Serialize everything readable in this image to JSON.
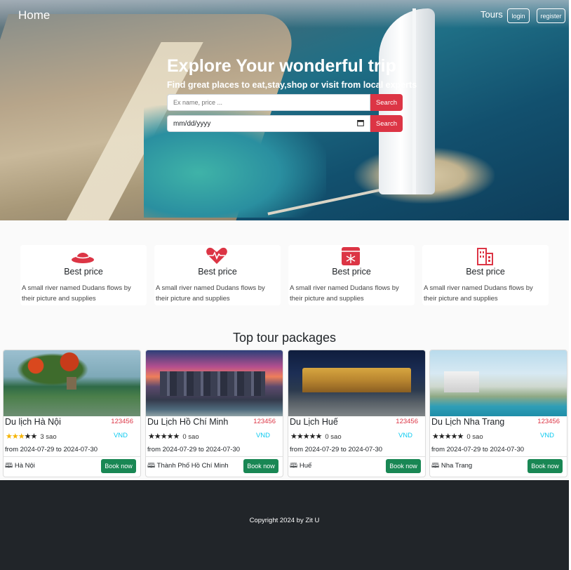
{
  "navbar": {
    "brand": "Home",
    "tours_link": "Tours",
    "login_button": "login",
    "register_button": "register"
  },
  "hero": {
    "title": "Explore Your wonderful trip",
    "subtitle": "Find great places to eat,stay,shop or visit from local experts",
    "search_placeholder": "Ex name, price ...",
    "date_placeholder": "mm/dd/yyyy",
    "search_button": "Search",
    "date_search_button": "Search"
  },
  "features": [
    {
      "icon": "hat-icon",
      "title": "Best price",
      "description": "A small river named Dudans flows by their picture and supplies"
    },
    {
      "icon": "heart-pulse-icon",
      "title": "Best price",
      "description": "A small river named Dudans flows by their picture and supplies"
    },
    {
      "icon": "snowflake-box-icon",
      "title": "Best price",
      "description": "A small river named Dudans flows by their picture and supplies"
    },
    {
      "icon": "building-icon",
      "title": "Best price",
      "description": "A small river named Dudans flows by their picture and supplies"
    }
  ],
  "section_title": "Top tour packages",
  "tours": [
    {
      "name": "Du lịch Hà Nội",
      "price": "123456",
      "currency": "VND",
      "rating": 3,
      "rating_text": "3 sao",
      "date_from": "2024-07-29",
      "date_to": "2024-07-30",
      "location": "Hà Nội",
      "book_label": "Book now"
    },
    {
      "name": "Du Lịch Hồ Chí Minh",
      "price": "123456",
      "currency": "VND",
      "rating": 0,
      "rating_text": "0 sao",
      "date_from": "2024-07-29",
      "date_to": "2024-07-30",
      "location": "Thành Phố Hồ Chí Minh",
      "book_label": "Book now"
    },
    {
      "name": "Du Lịch Huế",
      "price": "123456",
      "currency": "VND",
      "rating": 0,
      "rating_text": "0 sao",
      "date_from": "2024-07-29",
      "date_to": "2024-07-30",
      "location": "Huế",
      "book_label": "Book now"
    },
    {
      "name": "Du Lịch Nha Trang",
      "price": "123456",
      "currency": "VND",
      "rating": 0,
      "rating_text": "0 sao",
      "date_from": "2024-07-29",
      "date_to": "2024-07-30",
      "location": "Nha Trang",
      "book_label": "Book now"
    }
  ],
  "labels": {
    "date_from_prefix": "from",
    "date_to_sep": "to"
  },
  "footer": {
    "copyright": "Copyright 2024 by Zit U"
  },
  "colors": {
    "accent_red": "#dc3545",
    "book_green": "#198754",
    "footer_bg": "#212529",
    "star_yellow": "#f5b301",
    "currency_cyan": "#0dcaf0"
  }
}
